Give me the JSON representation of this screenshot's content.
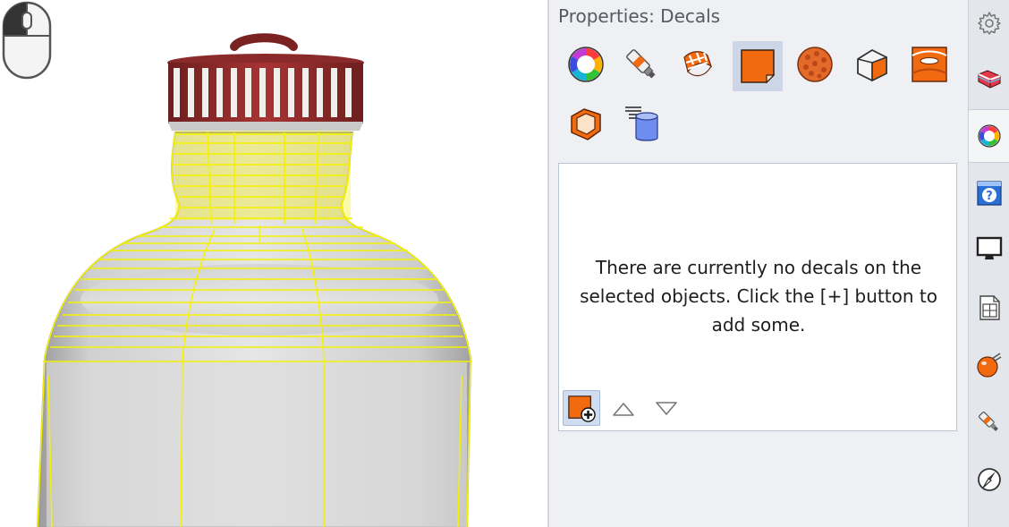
{
  "panel": {
    "title": "Properties: Decals",
    "empty_message": "There are currently no decals on the selected objects. Click the [+] button to add some.",
    "active_tool": "decals-icon",
    "toolbar_icons": [
      "color-wheel-icon",
      "paint-tube-icon",
      "checker-ribbon-icon",
      "decals-icon",
      "bumpy-sphere-icon",
      "rounded-box-icon",
      "mapping-panel-icon",
      "box-wireframe-icon",
      "cylinder-list-icon"
    ],
    "list_buttons": [
      "add-decal-icon",
      "move-up-icon",
      "move-down-icon"
    ]
  },
  "side_tabs": [
    "gear-icon",
    "layers-icon",
    "material-color-icon",
    "help-icon",
    "display-icon",
    "page-layout-icon",
    "ball-with-light-icon",
    "paint-brush-icon",
    "compass-icon"
  ],
  "viewport": {
    "object": "bottle-model",
    "selection_color": "#f5f200",
    "cap_color": "#8b2a2a"
  },
  "colors": {
    "accent_orange": "#f26a10",
    "active_tool_bg": "#cdd6e7",
    "panel_bg": "#eef0f3"
  }
}
